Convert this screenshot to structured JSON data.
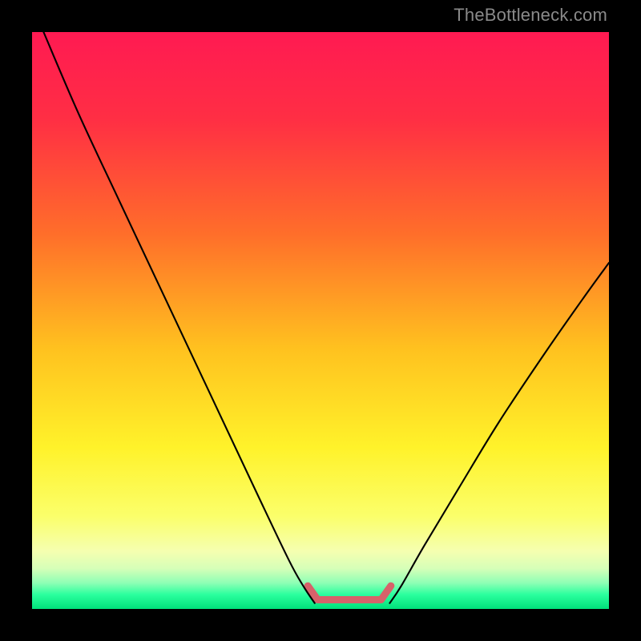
{
  "watermark": "TheBottleneck.com",
  "chart_data": {
    "type": "line",
    "title": "",
    "xlabel": "",
    "ylabel": "",
    "xlim": [
      0,
      1
    ],
    "ylim": [
      0,
      1
    ],
    "series": [
      {
        "name": "left-curve",
        "x": [
          0.02,
          0.08,
          0.15,
          0.23,
          0.31,
          0.39,
          0.445,
          0.47,
          0.49
        ],
        "y": [
          1.0,
          0.86,
          0.71,
          0.54,
          0.37,
          0.2,
          0.085,
          0.04,
          0.01
        ]
      },
      {
        "name": "right-curve",
        "x": [
          0.62,
          0.64,
          0.68,
          0.74,
          0.81,
          0.89,
          0.96,
          1.0
        ],
        "y": [
          0.01,
          0.04,
          0.11,
          0.21,
          0.325,
          0.445,
          0.545,
          0.6
        ]
      },
      {
        "name": "bottom-bracket",
        "x": [
          0.478,
          0.495,
          0.56,
          0.605,
          0.622
        ],
        "y": [
          0.04,
          0.016,
          0.016,
          0.016,
          0.04
        ]
      }
    ],
    "gradient_stops": [
      {
        "offset": 0.0,
        "color": "#ff1a52"
      },
      {
        "offset": 0.15,
        "color": "#ff2e44"
      },
      {
        "offset": 0.35,
        "color": "#ff6e2a"
      },
      {
        "offset": 0.55,
        "color": "#ffc21f"
      },
      {
        "offset": 0.72,
        "color": "#fff22a"
      },
      {
        "offset": 0.84,
        "color": "#fbff6b"
      },
      {
        "offset": 0.9,
        "color": "#f5ffb0"
      },
      {
        "offset": 0.93,
        "color": "#d6ffb8"
      },
      {
        "offset": 0.955,
        "color": "#8dffb5"
      },
      {
        "offset": 0.975,
        "color": "#2bff9e"
      },
      {
        "offset": 1.0,
        "color": "#00e07a"
      }
    ],
    "styles": {
      "curve_stroke": "#000000",
      "curve_stroke_width": 2.1,
      "bracket_stroke": "#d7626a",
      "bracket_stroke_width": 9
    }
  }
}
